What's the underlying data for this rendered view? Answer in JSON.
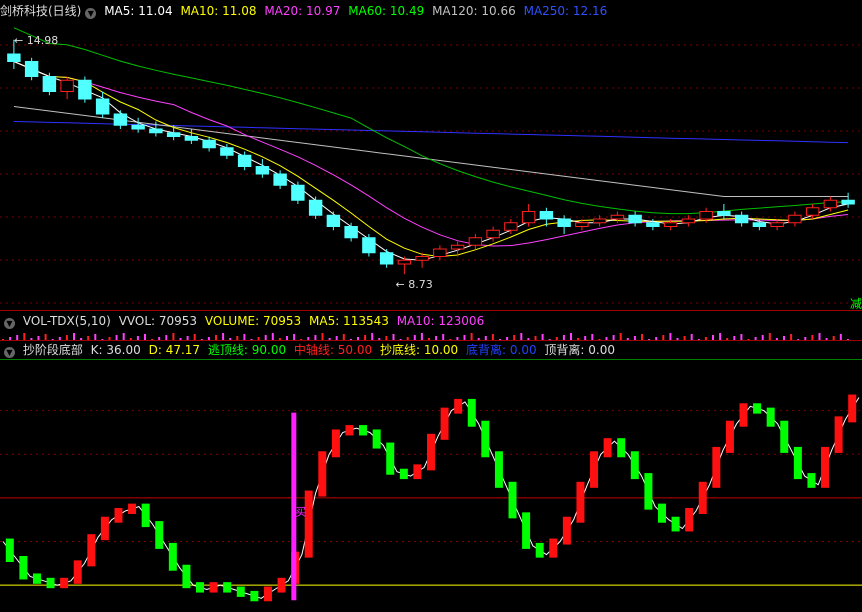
{
  "main_header": {
    "title": "剑桥科技(日线)",
    "ma5": "MA5: 11.04",
    "ma10": "MA10: 11.08",
    "ma20": "MA20: 10.97",
    "ma60": "MA60: 10.49",
    "ma120": "MA120: 10.66",
    "ma250": "MA250: 12.16"
  },
  "price_high_label": "14.98",
  "price_low_label": "8.73",
  "right_edge_label": "减",
  "vol_header": {
    "title": "VOL-TDX(5,10)",
    "vvol": "VVOL: 70953",
    "volume": "VOLUME: 70953",
    "ma5": "MA5: 113543",
    "ma10": "MA10: 123006"
  },
  "ind_header": {
    "title": "抄阶段底部",
    "k": "K: 36.00",
    "d": "D: 47.17",
    "escape": "逃顶线: 90.00",
    "middle": "中轴线: 50.00",
    "bottom": "抄底线: 10.00",
    "bottom_div": "底背离: 0.00",
    "top_div": "顶背离: 0.00"
  },
  "buy_label": "买",
  "colors": {
    "up": "#ff2020",
    "down": "#50ffff",
    "ma5": "#ffffff",
    "ma10": "#ffff00",
    "ma20": "#ff40ff",
    "ma60": "#00c000",
    "ma120": "#c0c0c0",
    "ma250": "#3030ff",
    "kup": "#ff1010",
    "kdown": "#00ff00"
  },
  "chart_data": [
    {
      "type": "candlestick",
      "title": "剑桥科技(日线)",
      "annotations": [
        {
          "label": "14.98",
          "kind": "high"
        },
        {
          "label": "8.73",
          "kind": "low"
        }
      ],
      "ohlc_approx": [
        [
          14.6,
          14.98,
          14.2,
          14.4
        ],
        [
          14.4,
          14.5,
          13.9,
          14.0
        ],
        [
          14.0,
          14.1,
          13.5,
          13.6
        ],
        [
          13.6,
          14.0,
          13.4,
          13.9
        ],
        [
          13.9,
          14.0,
          13.3,
          13.4
        ],
        [
          13.4,
          13.6,
          12.9,
          13.0
        ],
        [
          13.0,
          13.1,
          12.6,
          12.7
        ],
        [
          12.7,
          12.9,
          12.5,
          12.6
        ],
        [
          12.6,
          12.8,
          12.4,
          12.5
        ],
        [
          12.5,
          12.7,
          12.3,
          12.4
        ],
        [
          12.4,
          12.6,
          12.2,
          12.3
        ],
        [
          12.3,
          12.4,
          12.0,
          12.1
        ],
        [
          12.1,
          12.2,
          11.8,
          11.9
        ],
        [
          11.9,
          12.0,
          11.5,
          11.6
        ],
        [
          11.6,
          11.8,
          11.3,
          11.4
        ],
        [
          11.4,
          11.5,
          11.0,
          11.1
        ],
        [
          11.1,
          11.2,
          10.6,
          10.7
        ],
        [
          10.7,
          10.8,
          10.2,
          10.3
        ],
        [
          10.3,
          10.4,
          9.9,
          10.0
        ],
        [
          10.0,
          10.1,
          9.6,
          9.7
        ],
        [
          9.7,
          9.8,
          9.2,
          9.3
        ],
        [
          9.3,
          9.4,
          8.9,
          9.0
        ],
        [
          9.0,
          9.2,
          8.73,
          9.1
        ],
        [
          9.1,
          9.3,
          8.9,
          9.2
        ],
        [
          9.2,
          9.5,
          9.1,
          9.4
        ],
        [
          9.4,
          9.6,
          9.2,
          9.5
        ],
        [
          9.5,
          9.8,
          9.4,
          9.7
        ],
        [
          9.7,
          10.0,
          9.6,
          9.9
        ],
        [
          9.9,
          10.2,
          9.8,
          10.1
        ],
        [
          10.1,
          10.6,
          10.0,
          10.4
        ],
        [
          10.4,
          10.5,
          10.0,
          10.2
        ],
        [
          10.2,
          10.3,
          9.8,
          10.0
        ],
        [
          10.0,
          10.2,
          9.9,
          10.1
        ],
        [
          10.1,
          10.3,
          10.0,
          10.2
        ],
        [
          10.2,
          10.4,
          10.1,
          10.3
        ],
        [
          10.3,
          10.4,
          10.0,
          10.1
        ],
        [
          10.1,
          10.2,
          9.9,
          10.0
        ],
        [
          10.0,
          10.2,
          9.9,
          10.1
        ],
        [
          10.1,
          10.3,
          10.0,
          10.2
        ],
        [
          10.2,
          10.5,
          10.1,
          10.4
        ],
        [
          10.4,
          10.6,
          10.2,
          10.3
        ],
        [
          10.3,
          10.4,
          10.0,
          10.1
        ],
        [
          10.1,
          10.2,
          9.9,
          10.0
        ],
        [
          10.0,
          10.2,
          9.9,
          10.1
        ],
        [
          10.1,
          10.4,
          10.0,
          10.3
        ],
        [
          10.3,
          10.6,
          10.2,
          10.5
        ],
        [
          10.5,
          10.8,
          10.4,
          10.7
        ],
        [
          10.7,
          10.9,
          10.5,
          10.6
        ]
      ]
    },
    {
      "type": "line",
      "title": "抄阶段底部",
      "levels": [
        {
          "name": "逃顶线",
          "value": 90
        },
        {
          "name": "中轴线",
          "value": 50
        },
        {
          "name": "抄底线",
          "value": 10
        }
      ],
      "ylim": [
        0,
        110
      ],
      "k_values": [
        30,
        22,
        14,
        12,
        10,
        12,
        20,
        32,
        40,
        44,
        46,
        38,
        28,
        18,
        10,
        8,
        10,
        8,
        6,
        4,
        8,
        12,
        24,
        52,
        70,
        80,
        82,
        80,
        74,
        62,
        60,
        64,
        78,
        90,
        94,
        84,
        70,
        56,
        42,
        28,
        24,
        30,
        40,
        56,
        70,
        76,
        70,
        60,
        46,
        40,
        36,
        44,
        56,
        72,
        84,
        92,
        90,
        84,
        72,
        60,
        56,
        72,
        86,
        96
      ],
      "buy_signal_index": 21
    }
  ]
}
